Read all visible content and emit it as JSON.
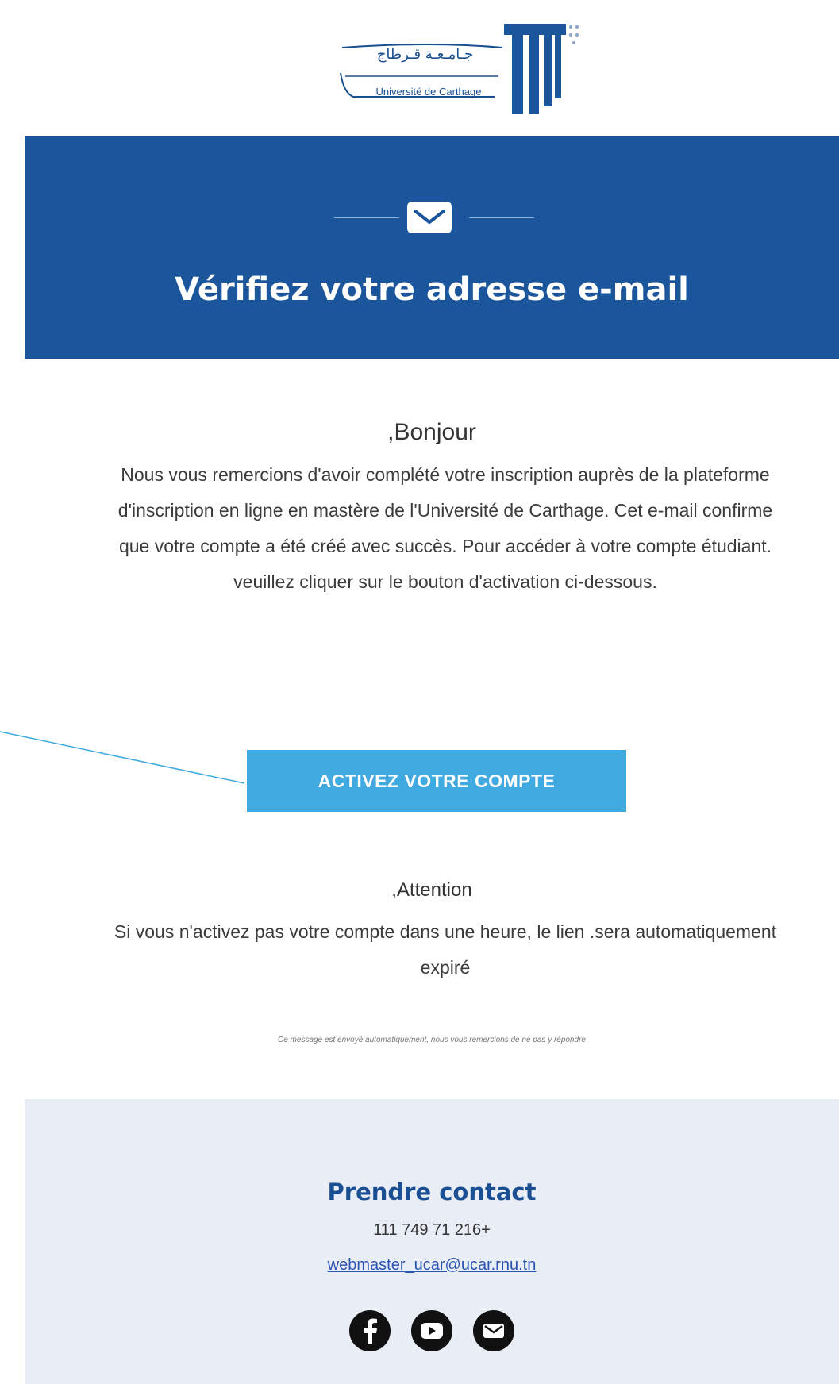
{
  "header": {
    "logo_ar": "جـامـعـة قـرطاج",
    "logo_fr": "Université de Carthage",
    "title": "Vérifiez votre adresse e-mail"
  },
  "body": {
    "greeting": ",Bonjour",
    "paragraph": "Nous vous remercions d'avoir complété votre inscription auprès de la plateforme d'inscription en ligne en mastère de l'Université de Carthage. Cet e-mail confirme que votre compte a été créé avec succès. Pour accéder à votre compte étudiant. veuillez cliquer sur le bouton d'activation ci-dessous.",
    "cta_label": "ACTIVEZ VOTRE COMPTE",
    "attention_title": ",Attention",
    "attention_text": "Si vous n'activez pas votre compte dans une heure, le lien .sera automatiquement expiré",
    "note": "Ce message est envoyé automatiquement, nous vous remercions de ne pas y répondre"
  },
  "footer": {
    "contact_title": "Prendre contact",
    "phone": "111 749 71 216+",
    "email": "webmaster_ucar@ucar.rnu.tn",
    "socials": [
      "facebook-icon",
      "youtube-icon",
      "email-icon"
    ]
  },
  "colors": {
    "banner": "#1b559b",
    "button": "#3fa9e0",
    "footer": "#e9edf5",
    "contact_title": "#1b4f94"
  }
}
